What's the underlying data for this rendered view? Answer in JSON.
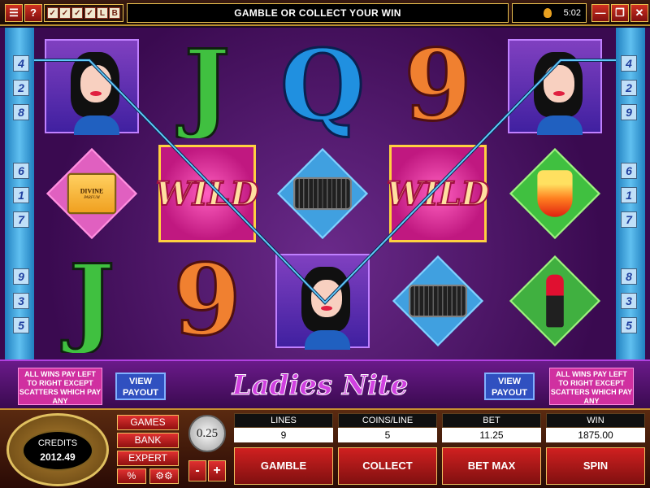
{
  "top_bar": {
    "menu_icon": "menu-icon",
    "help_label": "?",
    "option_icons": [
      "check",
      "check",
      "check",
      "check",
      "L",
      "B"
    ],
    "message": "GAMBLE OR COLLECT YOUR WIN",
    "time": "5:02",
    "window_controls": [
      "minimize-icon",
      "restore-icon",
      "close-icon"
    ],
    "accent": "#e8c050"
  },
  "paylines": {
    "left": [
      "4",
      "2",
      "8",
      "6",
      "1",
      "7",
      "9",
      "3",
      "5"
    ],
    "right": [
      "4",
      "2",
      "9",
      "6",
      "1",
      "7",
      "8",
      "3",
      "5"
    ]
  },
  "reels": [
    [
      "lady",
      "perfume",
      "J"
    ],
    [
      "J",
      "WILD",
      "9"
    ],
    [
      "Q",
      "purse",
      "lady"
    ],
    [
      "9",
      "WILD",
      "purse"
    ],
    [
      "lady",
      "cocktail",
      "lipstick"
    ]
  ],
  "symbol_text": {
    "wild": "WILD",
    "perfume_brand": "DIVINE",
    "perfume_sub": "PARFUM"
  },
  "info": {
    "rule_left": "ALL WINS PAY LEFT TO RIGHT EXCEPT SCATTERS WHICH PAY ANY",
    "rule_right": "ALL WINS PAY LEFT TO RIGHT EXCEPT SCATTERS WHICH PAY ANY",
    "view_payout": "VIEW PAYOUT",
    "logo": "Ladies Nite"
  },
  "console": {
    "credits_label": "CREDITS",
    "credits_value": "2012.49",
    "menu": {
      "games": "GAMES",
      "bank": "BANK",
      "expert": "EXPERT",
      "percent": "%",
      "settings_icon": "gears-icon"
    },
    "coin_value": "0.25",
    "minus": "-",
    "plus": "+",
    "lines_label": "LINES",
    "lines_value": "9",
    "coins_label": "COINS/LINE",
    "coins_value": "5",
    "bet_label": "BET",
    "bet_value": "11.25",
    "win_label": "WIN",
    "win_value": "1875.00",
    "gamble": "GAMBLE",
    "collect": "COLLECT",
    "bet_max": "BET MAX",
    "spin": "SPIN"
  }
}
